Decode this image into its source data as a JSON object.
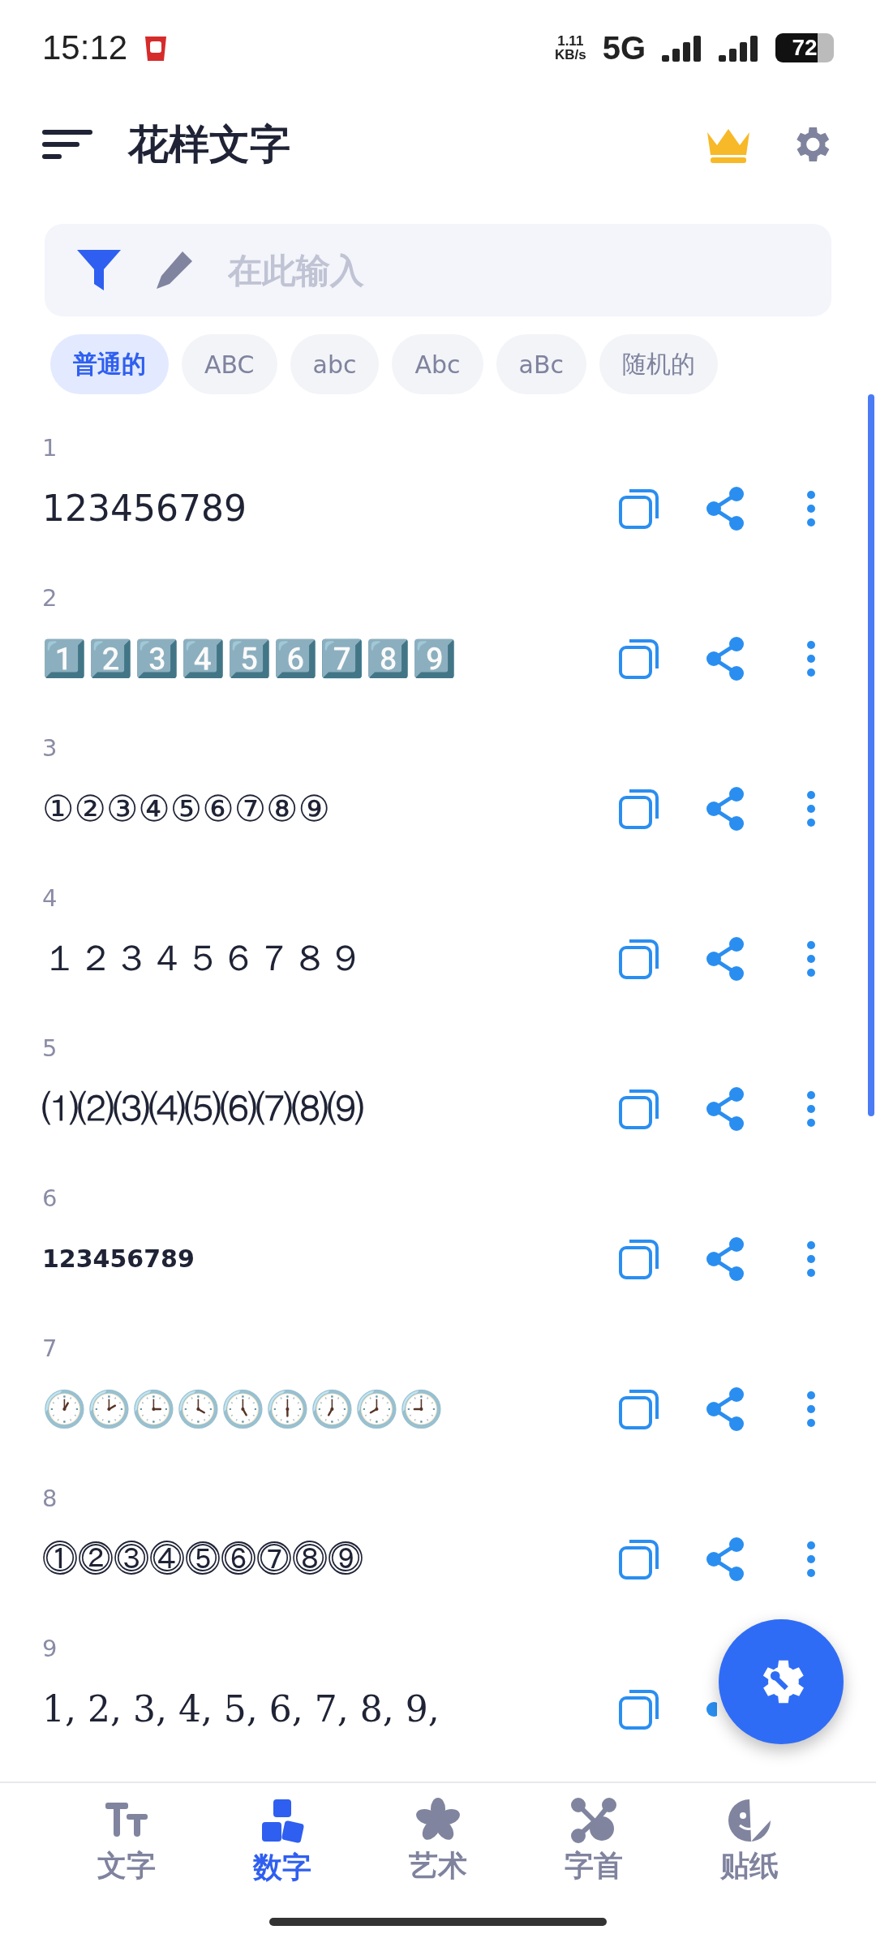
{
  "status_bar": {
    "time": "15:12",
    "net_speed_value": "1.11",
    "net_speed_unit": "KB/s",
    "network": "5G",
    "battery": "72"
  },
  "header": {
    "title": "花样文字"
  },
  "search": {
    "placeholder": "在此输入"
  },
  "chips": [
    {
      "label": "普通的",
      "selected": true
    },
    {
      "label": "ABC",
      "selected": false
    },
    {
      "label": "abc",
      "selected": false
    },
    {
      "label": "Abc",
      "selected": false
    },
    {
      "label": "aBc",
      "selected": false
    },
    {
      "label": "随机的",
      "selected": false
    }
  ],
  "results": [
    {
      "index": "1",
      "text": "123456789",
      "kind": "plain"
    },
    {
      "index": "2",
      "text": "1️⃣2️⃣3️⃣4️⃣5️⃣6️⃣7️⃣8️⃣9️⃣",
      "kind": "keycap"
    },
    {
      "index": "3",
      "text": "①②③④⑤⑥⑦⑧⑨",
      "kind": "plain"
    },
    {
      "index": "4",
      "text": "１２３４５６７８９",
      "kind": "plain"
    },
    {
      "index": "5",
      "text": "⑴⑵⑶⑷⑸⑹⑺⑻⑼",
      "kind": "plain"
    },
    {
      "index": "6",
      "text": "𝟭𝟮𝟯𝟰𝟱𝟲𝟳𝟴𝟵",
      "kind": "small"
    },
    {
      "index": "7",
      "text": "🕐🕑🕒🕓🕔🕕🕖🕗🕘",
      "kind": "plain"
    },
    {
      "index": "8",
      "text": "⓵⓶⓷⓸⓹⓺⓻⓼⓽",
      "kind": "plain"
    },
    {
      "index": "9",
      "text": "1, 2, 3, 4, 5, 6, 7, 8, 9,",
      "kind": "serif"
    }
  ],
  "bottom_nav": [
    {
      "label": "文字",
      "selected": false
    },
    {
      "label": "数字",
      "selected": true
    },
    {
      "label": "艺术",
      "selected": false
    },
    {
      "label": "字首",
      "selected": false
    },
    {
      "label": "贴纸",
      "selected": false
    }
  ]
}
